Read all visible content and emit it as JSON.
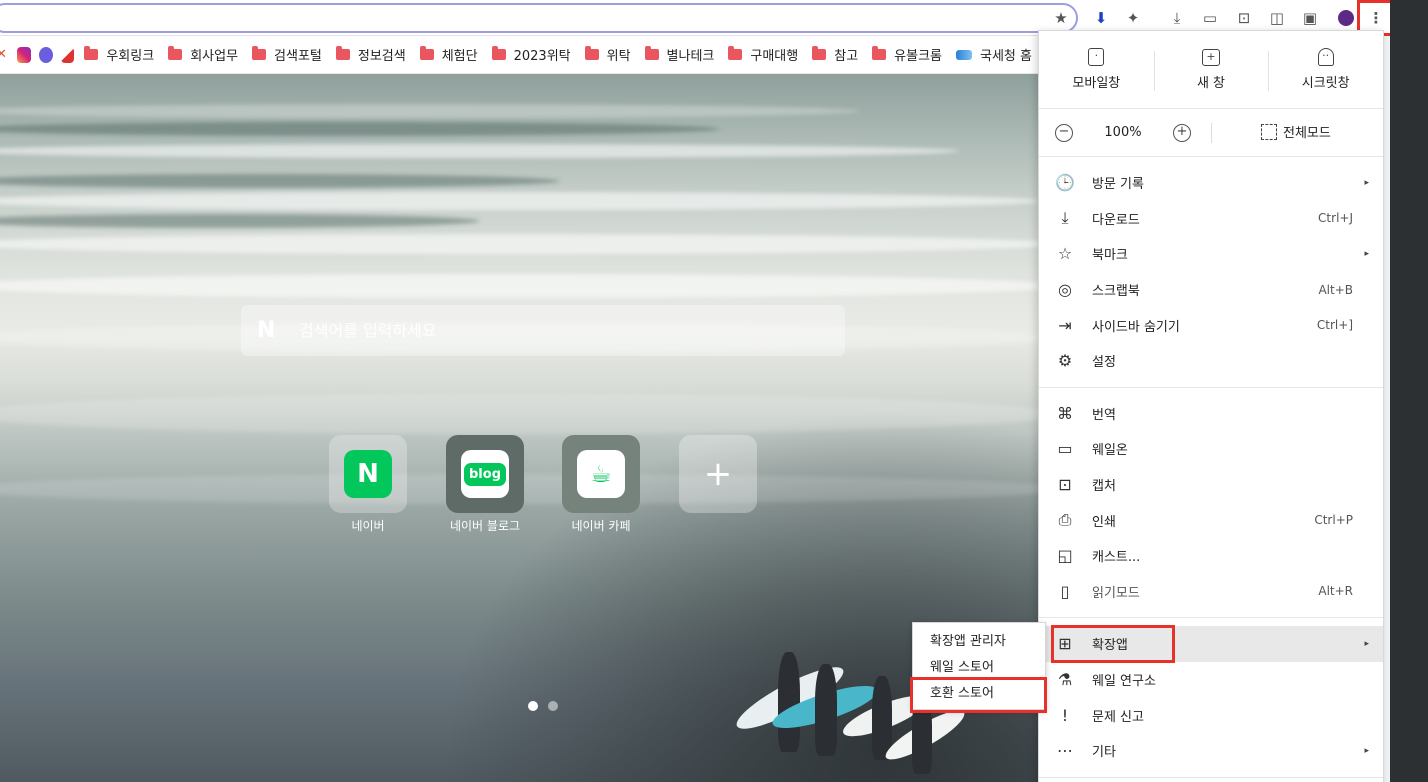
{
  "bookmarks": [
    {
      "label": "우회링크",
      "type": "folder"
    },
    {
      "label": "회사업무",
      "type": "folder"
    },
    {
      "label": "검색포털",
      "type": "folder"
    },
    {
      "label": "정보검색",
      "type": "folder"
    },
    {
      "label": "체험단",
      "type": "folder"
    },
    {
      "label": "2023위탁",
      "type": "folder"
    },
    {
      "label": "위탁",
      "type": "folder"
    },
    {
      "label": "별나테크",
      "type": "folder"
    },
    {
      "label": "구매대행",
      "type": "folder"
    },
    {
      "label": "참고",
      "type": "folder"
    },
    {
      "label": "유볼크롬",
      "type": "folder"
    },
    {
      "label": "국세청 홈",
      "type": "site"
    }
  ],
  "search": {
    "placeholder": "검색어를 입력하세요",
    "logo": "N"
  },
  "shortcuts": [
    {
      "label": "네이버",
      "inner": "N"
    },
    {
      "label": "네이버 블로그",
      "inner": "blog"
    },
    {
      "label": "네이버 카페",
      "inner": "☕"
    },
    {
      "label": "",
      "inner": "+"
    }
  ],
  "menu": {
    "top_buttons": [
      {
        "label": "모바일창"
      },
      {
        "label": "새 창"
      },
      {
        "label": "시크릿창"
      }
    ],
    "zoom": {
      "minus": "−",
      "value": "100%",
      "plus": "+",
      "fullscreen": "전체모드"
    },
    "groups": [
      [
        {
          "label": "방문 기록",
          "icon": "clock-icon",
          "glyph": "🕒",
          "arrow": "▸"
        },
        {
          "label": "다운로드",
          "icon": "download-icon",
          "glyph": "⤓",
          "shortcut": "Ctrl+J"
        },
        {
          "label": "북마크",
          "icon": "star-icon",
          "glyph": "☆",
          "arrow": "▸"
        },
        {
          "label": "스크랩북",
          "icon": "scrapbook-icon",
          "glyph": "◎",
          "shortcut": "Alt+B"
        },
        {
          "label": "사이드바 숨기기",
          "icon": "sidebar-icon",
          "glyph": "⇥",
          "shortcut": "Ctrl+]"
        },
        {
          "label": "설정",
          "icon": "gear-icon",
          "glyph": "⚙"
        }
      ],
      [
        {
          "label": "번역",
          "icon": "translate-icon",
          "glyph": "⌘"
        },
        {
          "label": "웨일온",
          "icon": "video-icon",
          "glyph": "▭"
        },
        {
          "label": "캡처",
          "icon": "capture-icon",
          "glyph": "⊡"
        },
        {
          "label": "인쇄",
          "icon": "print-icon",
          "glyph": "⎙",
          "shortcut": "Ctrl+P"
        },
        {
          "label": "캐스트...",
          "icon": "cast-icon",
          "glyph": "◱"
        },
        {
          "label": "읽기모드",
          "icon": "reader-icon",
          "glyph": "▯",
          "shortcut": "Alt+R",
          "disabled": true
        }
      ],
      [
        {
          "label": "확장앱",
          "icon": "extensions-icon",
          "glyph": "⊞",
          "arrow": "▸",
          "active": true
        },
        {
          "label": "웨일 연구소",
          "icon": "flask-icon",
          "glyph": "⚗"
        },
        {
          "label": "문제 신고",
          "icon": "report-icon",
          "glyph": "!"
        },
        {
          "label": "기타",
          "icon": "more-icon",
          "glyph": "⋯",
          "arrow": "▸"
        }
      ]
    ]
  },
  "submenu": [
    "확장앱 관리자",
    "웨일 스토어",
    "호환 스토어"
  ],
  "colors": {
    "highlight": "#e8312a",
    "folder": "#e9565f",
    "naver_green": "#03c75a"
  }
}
